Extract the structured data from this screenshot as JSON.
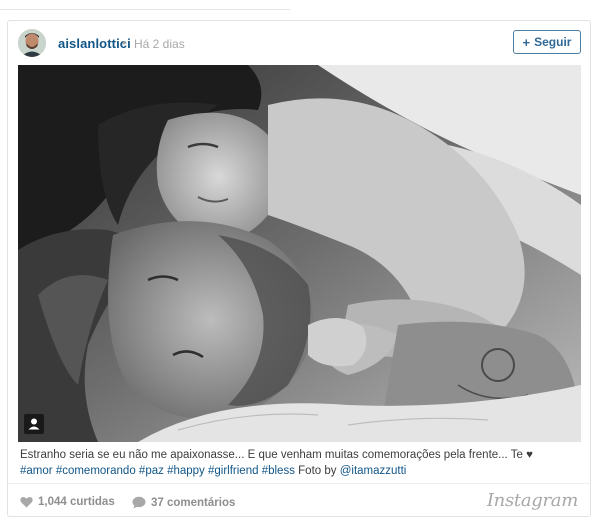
{
  "post": {
    "username": "aislanlottici",
    "separator": "•",
    "time_ago": "Há 2 dias",
    "follow_label": "Seguir",
    "follow_icon": "plus-icon",
    "photo_icon": "user-tag-icon"
  },
  "caption": {
    "text": "Estranho seria se eu não me apaixonasse... E que venham muitas comemorações pela frente... Te ♥",
    "hashtags": [
      "#amor",
      "#comemorando",
      "#paz",
      "#happy",
      "#girlfriend",
      "#bless"
    ],
    "photo_by_label": "Foto by",
    "photo_by_user": "@itamazzutti"
  },
  "footer": {
    "likes": "1,044 curtidas",
    "comments": "37 comentários",
    "brand": "Instagram",
    "like_icon": "heart-icon",
    "comment_icon": "comment-bubble-icon"
  },
  "colors": {
    "link": "#125688",
    "muted": "#a8a8a8",
    "text": "#3d3d3d"
  }
}
